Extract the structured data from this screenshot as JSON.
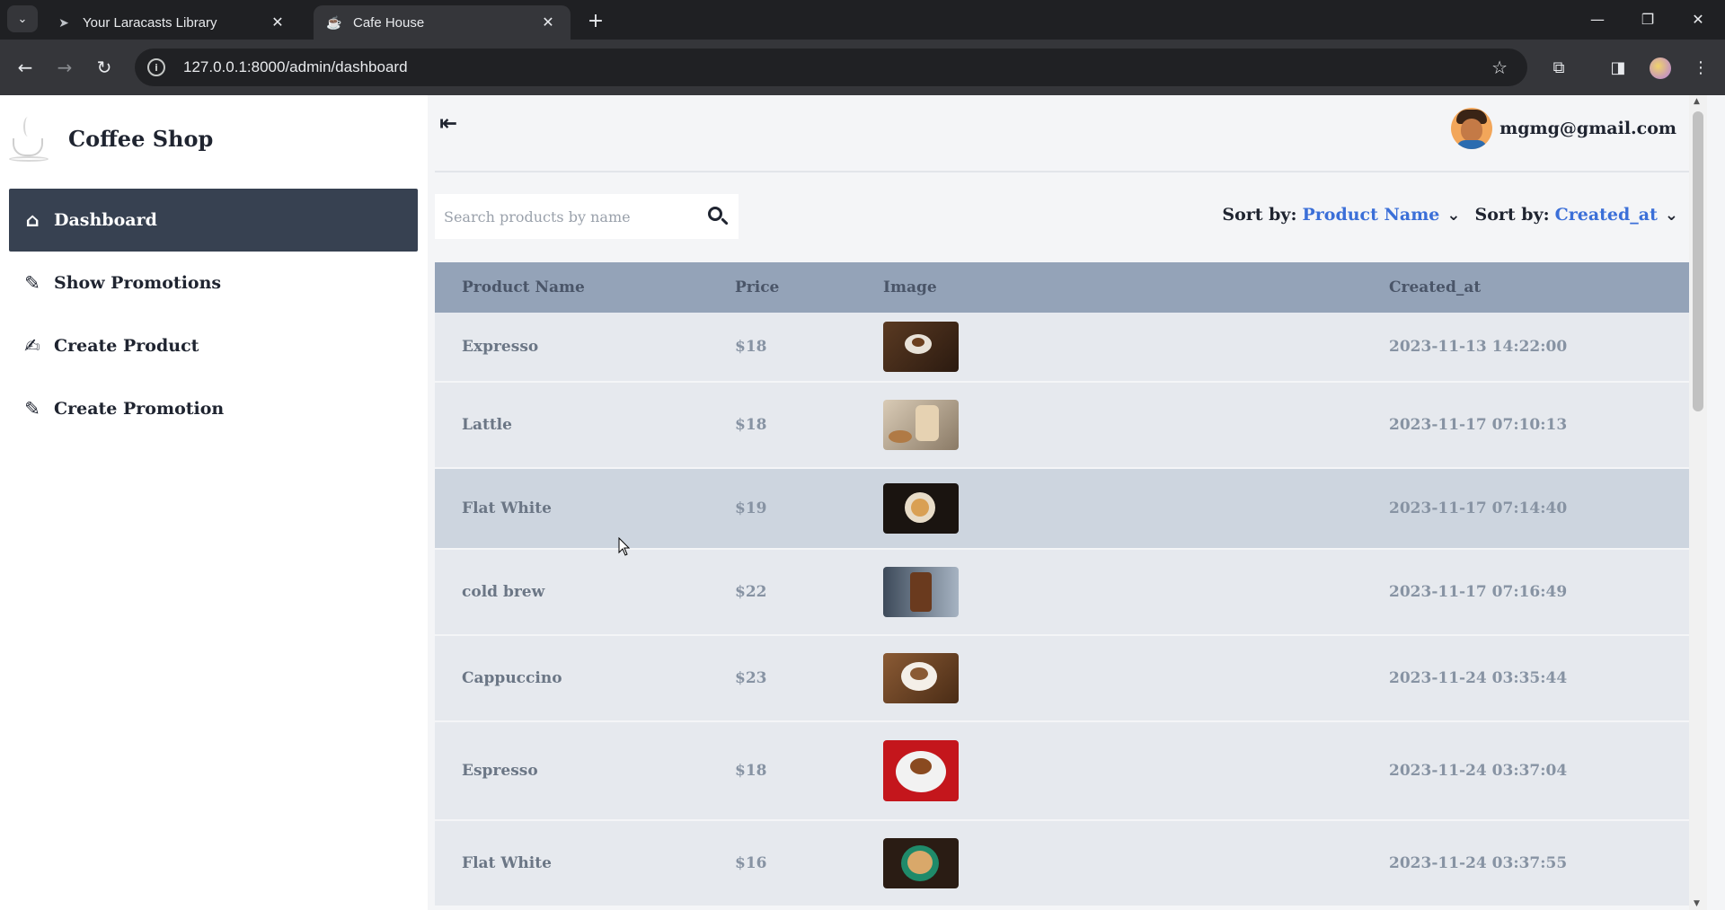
{
  "browser": {
    "tabs": [
      {
        "title": "Your Laracasts Library",
        "favicon": "paper-plane-icon",
        "active": false
      },
      {
        "title": "Cafe House",
        "favicon": "coffee-icon",
        "active": true
      }
    ],
    "url": "127.0.0.1:8000/admin/dashboard"
  },
  "sidebar": {
    "brand": "Coffee Shop",
    "items": [
      {
        "label": "Dashboard",
        "icon": "home-icon",
        "active": true
      },
      {
        "label": "Show Promotions",
        "icon": "pen-icon",
        "active": false
      },
      {
        "label": "Create Product",
        "icon": "edit-icon",
        "active": false
      },
      {
        "label": "Create Promotion",
        "icon": "pen-icon",
        "active": false
      }
    ]
  },
  "header": {
    "user_email": "mgmg@gmail.com"
  },
  "search": {
    "placeholder": "Search products by name",
    "value": ""
  },
  "sort": [
    {
      "label": "Sort by:",
      "value": "Product Name"
    },
    {
      "label": "Sort by:",
      "value": "Created_at"
    }
  ],
  "table": {
    "columns": [
      "Product Name",
      "Price",
      "Image",
      "Created_at"
    ],
    "rows": [
      {
        "name": "Expresso",
        "price": "$18",
        "image": "espresso-cup-image",
        "created_at": "2023-11-13 14:22:00"
      },
      {
        "name": "Lattle",
        "price": "$18",
        "image": "latte-glass-image",
        "created_at": "2023-11-17 07:10:13"
      },
      {
        "name": "Flat White",
        "price": "$19",
        "image": "flat-white-cup-image",
        "created_at": "2023-11-17 07:14:40"
      },
      {
        "name": "cold brew",
        "price": "$22",
        "image": "cold-brew-glass-image",
        "created_at": "2023-11-17 07:16:49"
      },
      {
        "name": "Cappuccino",
        "price": "$23",
        "image": "cappuccino-cup-image",
        "created_at": "2023-11-24 03:35:44"
      },
      {
        "name": "Espresso",
        "price": "$18",
        "image": "espresso-red-image",
        "created_at": "2023-11-24 03:37:04"
      },
      {
        "name": "Flat White",
        "price": "$16",
        "image": "flat-white-green-image",
        "created_at": "2023-11-24 03:37:55"
      }
    ]
  },
  "colors": {
    "sidebar_active": "#374151",
    "table_header": "#94a3b8",
    "row_bg": "#e6e9ee",
    "row_hover": "#cdd5df",
    "sort_value": "#3b6fd8"
  }
}
